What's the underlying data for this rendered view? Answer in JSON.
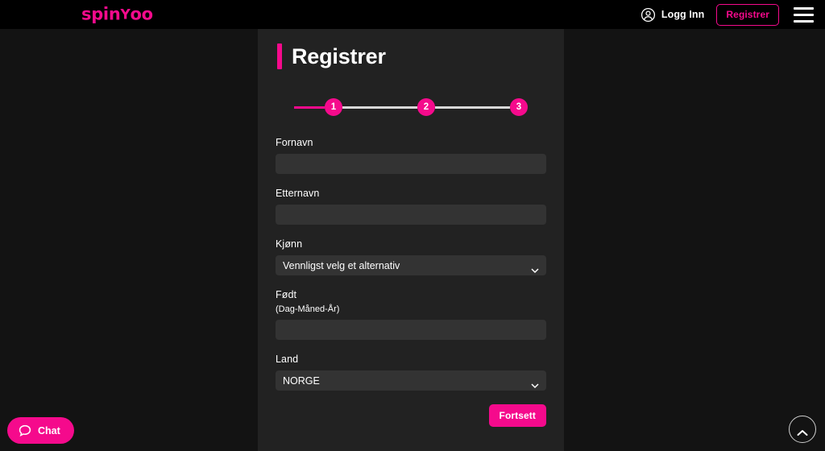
{
  "colors": {
    "brand_pink": "#F50A8C",
    "page_background": "#131313",
    "header_background": "#000000",
    "panel_background": "#222222",
    "input_background": "#333333",
    "step_line_inactive": "#d8d8d8"
  },
  "header": {
    "logo_text_part1": "spin",
    "logo_text_y": "Y",
    "logo_text_part2": "oo",
    "login_label": "Logg Inn",
    "register_label": "Registrer",
    "user_icon": "user-circle-icon",
    "menu_icon": "hamburger-menu-icon"
  },
  "main": {
    "page_title": "Registrer",
    "stepper": {
      "steps": [
        {
          "number": "1",
          "active": true
        },
        {
          "number": "2",
          "active": false
        },
        {
          "number": "3",
          "active": false
        }
      ]
    },
    "form": {
      "fields": [
        {
          "name": "first-name",
          "label": "Fornavn",
          "type": "text",
          "value": "",
          "placeholder": ""
        },
        {
          "name": "last-name",
          "label": "Etternavn",
          "type": "text",
          "value": "",
          "placeholder": ""
        },
        {
          "name": "gender",
          "label": "Kjønn",
          "type": "select",
          "value": "Vennligst velg et alternativ",
          "options": [
            "Vennligst velg et alternativ"
          ]
        },
        {
          "name": "birth-date",
          "label": "Født",
          "sublabel": "(Dag-Måned-År)",
          "type": "text",
          "value": "",
          "placeholder": ""
        },
        {
          "name": "country",
          "label": "Land",
          "type": "select",
          "value": "NORGE",
          "options": [
            "NORGE"
          ]
        }
      ],
      "submit_label": "Fortsett"
    }
  },
  "widgets": {
    "chat_label": "Chat",
    "chat_icon": "chat-bubble-icon",
    "scroll_top_icon": "chevron-up-icon"
  }
}
